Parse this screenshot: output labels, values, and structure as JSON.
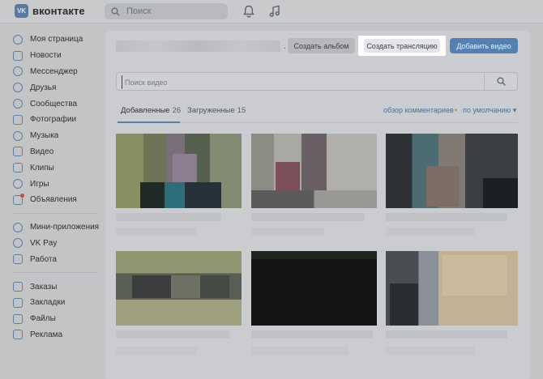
{
  "header": {
    "logo_mark": "VK",
    "logo_text": "вконтакте",
    "search_placeholder": "Поиск",
    "icons": [
      "bell-icon",
      "music-note-icon"
    ]
  },
  "sidebar": {
    "group1": [
      {
        "label": "Моя страница",
        "icon": "user-icon"
      },
      {
        "label": "Новости",
        "icon": "newspaper-icon"
      },
      {
        "label": "Мессенджер",
        "icon": "chat-icon"
      },
      {
        "label": "Друзья",
        "icon": "friends-icon"
      },
      {
        "label": "Сообщества",
        "icon": "communities-icon"
      },
      {
        "label": "Фотографии",
        "icon": "photo-icon"
      },
      {
        "label": "Музыка",
        "icon": "music-icon"
      },
      {
        "label": "Видео",
        "icon": "video-icon"
      },
      {
        "label": "Клипы",
        "icon": "clips-icon"
      },
      {
        "label": "Игры",
        "icon": "games-icon"
      },
      {
        "label": "Объявления",
        "icon": "ads-icon"
      }
    ],
    "group2": [
      {
        "label": "Мини-приложения",
        "icon": "apps-icon"
      },
      {
        "label": "VK Pay",
        "icon": "vkpay-icon"
      },
      {
        "label": "Работа",
        "icon": "work-icon"
      }
    ],
    "group3": [
      {
        "label": "Заказы",
        "icon": "orders-icon"
      },
      {
        "label": "Закладки",
        "icon": "bookmark-icon"
      },
      {
        "label": "Файлы",
        "icon": "files-icon"
      },
      {
        "label": "Реклама",
        "icon": "advertising-icon"
      }
    ]
  },
  "toolbar": {
    "dot": ".",
    "create_album": "Создать альбом",
    "create_stream": "Создать трансляцию",
    "add_video": "Добавить видео"
  },
  "video_search": {
    "placeholder": "Поиск видео"
  },
  "tabs": [
    {
      "label": "Добавленные",
      "count": "26"
    },
    {
      "label": "Загруженные",
      "count": "15"
    }
  ],
  "filters": {
    "comments_review": "обзор комментариев",
    "separator": "•",
    "sort": "по умолчанию",
    "sort_arrow": "▾"
  },
  "colors": {
    "accent": "#5580b2",
    "page_bg": "#c3c4c6",
    "panel_bg": "#cbcccf",
    "highlight": "#ffffff"
  }
}
